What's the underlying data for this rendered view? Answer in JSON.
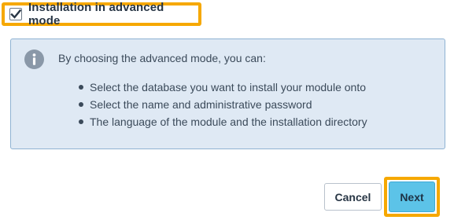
{
  "advanced_mode": {
    "label": "Installation in advanced mode",
    "checked": true
  },
  "info_panel": {
    "icon": "info-icon",
    "intro": "By choosing the advanced mode, you can:",
    "items": [
      "Select the database you want to install your module onto",
      "Select the name and administrative password",
      "The language of the module and the installation directory"
    ]
  },
  "buttons": {
    "cancel_label": "Cancel",
    "next_label": "Next"
  },
  "colors": {
    "highlight": "#f6a800",
    "panel_background": "#dfe9f4",
    "panel_border": "#8fb3d3",
    "primary_button": "#5cc3e8"
  }
}
